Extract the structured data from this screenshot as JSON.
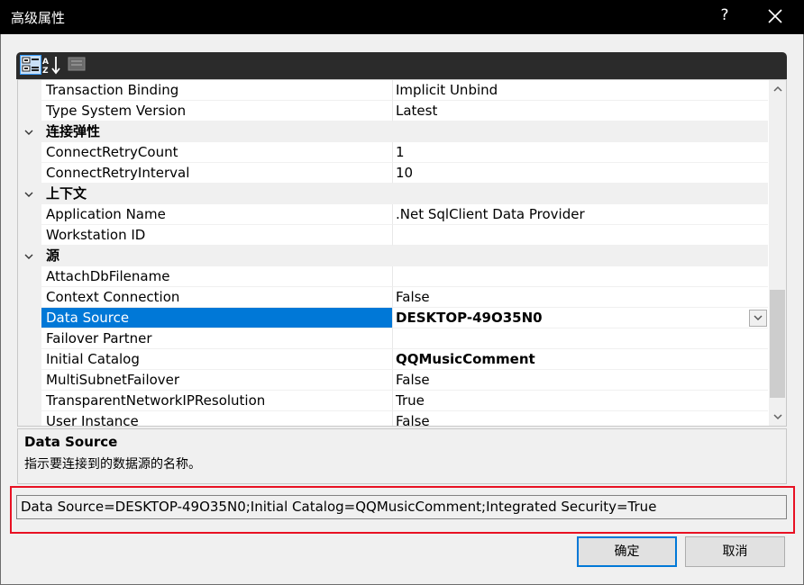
{
  "window": {
    "title": "高级属性",
    "help": "?"
  },
  "toolbar": {
    "categorized_icon": "categorized-icon",
    "alphabetical_icon": "sort-alpha-icon",
    "pages_icon": "property-pages-icon"
  },
  "grid": {
    "rows": [
      {
        "type": "property",
        "name": "Transaction Binding",
        "value": "Implicit Unbind",
        "bold": false
      },
      {
        "type": "property",
        "name": "Type System Version",
        "value": "Latest",
        "bold": false
      },
      {
        "type": "category",
        "name": "连接弹性"
      },
      {
        "type": "property",
        "name": "ConnectRetryCount",
        "value": "1",
        "bold": false
      },
      {
        "type": "property",
        "name": "ConnectRetryInterval",
        "value": "10",
        "bold": false
      },
      {
        "type": "category",
        "name": "上下文"
      },
      {
        "type": "property",
        "name": "Application Name",
        "value": ".Net SqlClient Data Provider",
        "bold": false
      },
      {
        "type": "property",
        "name": "Workstation ID",
        "value": "",
        "bold": false
      },
      {
        "type": "category",
        "name": "源"
      },
      {
        "type": "property",
        "name": "AttachDbFilename",
        "value": "",
        "bold": false
      },
      {
        "type": "property",
        "name": "Context Connection",
        "value": "False",
        "bold": false
      },
      {
        "type": "property",
        "name": "Data Source",
        "value": "DESKTOP-49O35N0",
        "bold": true,
        "selected": true
      },
      {
        "type": "property",
        "name": "Failover Partner",
        "value": "",
        "bold": false
      },
      {
        "type": "property",
        "name": "Initial Catalog",
        "value": "QQMusicComment",
        "bold": true
      },
      {
        "type": "property",
        "name": "MultiSubnetFailover",
        "value": "False",
        "bold": false
      },
      {
        "type": "property",
        "name": "TransparentNetworkIPResolution",
        "value": "True",
        "bold": false
      },
      {
        "type": "property",
        "name": "User Instance",
        "value": "False",
        "bold": false
      }
    ]
  },
  "description": {
    "title": "Data Source",
    "text": "指示要连接到的数据源的名称。"
  },
  "connection_string": "Data Source=DESKTOP-49O35N0;Initial Catalog=QQMusicComment;Integrated Security=True",
  "buttons": {
    "ok": "确定",
    "cancel": "取消"
  },
  "colors": {
    "selection": "#0078d7",
    "highlight_box": "#e81123",
    "titlebar": "#000000"
  }
}
